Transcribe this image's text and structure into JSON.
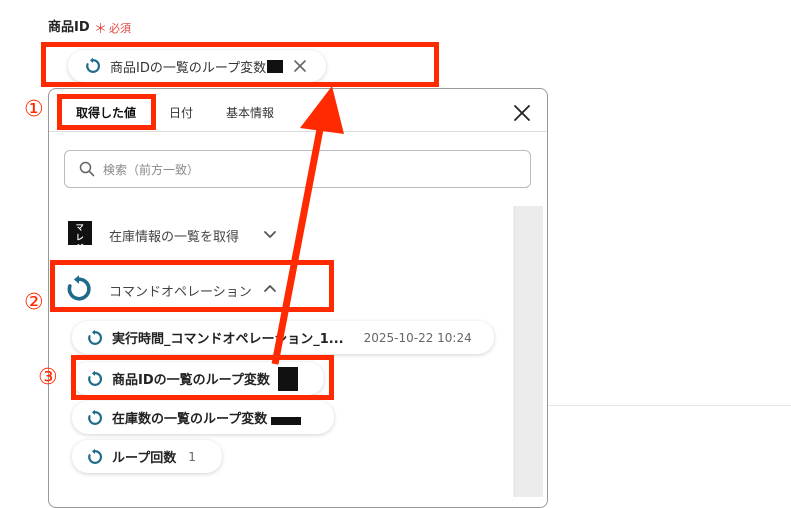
{
  "field": {
    "label": "商品ID",
    "required": "必須"
  },
  "selected_chip": {
    "label": "商品IDの一覧のループ変数"
  },
  "annotations": {
    "one": "①",
    "two": "②",
    "three": "③"
  },
  "tabs": [
    {
      "label": "取得した値",
      "active": true
    },
    {
      "label": "日付",
      "active": false
    },
    {
      "label": "基本情報",
      "active": false
    }
  ],
  "search": {
    "placeholder": "検索（前方一致）"
  },
  "sections": {
    "inventory": {
      "icon_text": "スマレジ",
      "title": "在庫情報の一覧を取得"
    },
    "command": {
      "title": "コマンドオペレーション"
    }
  },
  "items": [
    {
      "label": "実行時間_コマンドオペレーション_1...",
      "value": "2025-10-22 10:24"
    },
    {
      "label": "商品IDの一覧のループ変数",
      "value": ""
    },
    {
      "label": "在庫数の一覧のループ変数",
      "value": ""
    },
    {
      "label": "ループ回数",
      "value": "1"
    }
  ],
  "colors": {
    "accent": "#1e6a8a",
    "annotation": "#ff2a00",
    "required": "#e0473f"
  }
}
